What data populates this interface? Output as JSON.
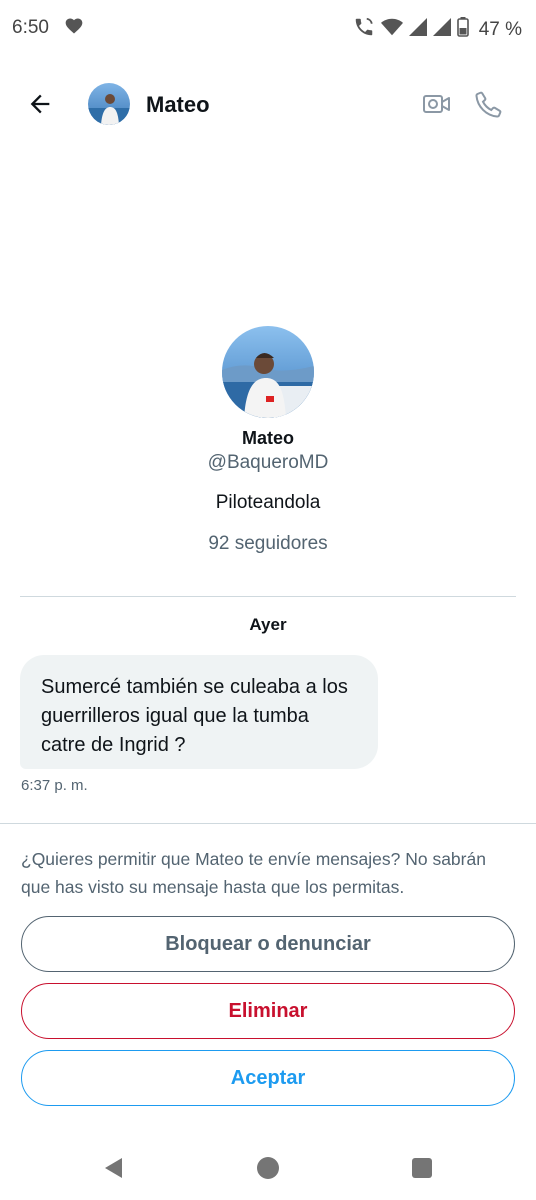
{
  "status_bar": {
    "time": "6:50",
    "battery": "47 %"
  },
  "header": {
    "name": "Mateo",
    "icons": [
      "arrow-left-icon",
      "video-camera-icon",
      "phone-icon"
    ]
  },
  "profile": {
    "name": "Mateo",
    "handle": "@BaqueroMD",
    "bio": "Piloteandola",
    "followers": "92 seguidores"
  },
  "conversation": {
    "day_label": "Ayer",
    "message": {
      "text": "Sumercé también se culeaba a los guerrilleros igual que la tumba catre de Ingrid ?",
      "time": "6:37 p. m."
    }
  },
  "request": {
    "text": "¿Quieres permitir que Mateo te envíe mensajes? No sabrán que has visto su mensaje hasta que los permitas.",
    "block_label": "Bloquear o denunciar",
    "delete_label": "Eliminar",
    "accept_label": "Aceptar"
  },
  "colors": {
    "accent": "#1d9bf0",
    "danger": "#c8102e",
    "secondary_text": "#536471",
    "bubble": "#eff3f4"
  }
}
